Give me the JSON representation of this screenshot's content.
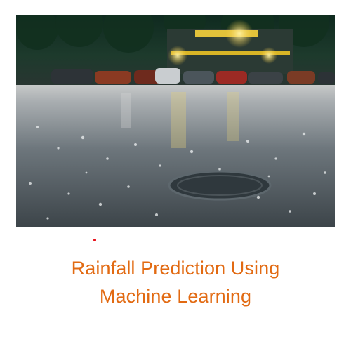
{
  "caption": {
    "line1": "Rainfall Prediction Using",
    "line2": "Machine Learning",
    "color": "#e26a12"
  },
  "photo": {
    "icon": "rainy-street-photo"
  },
  "accent_dot_color": "#e8101a"
}
